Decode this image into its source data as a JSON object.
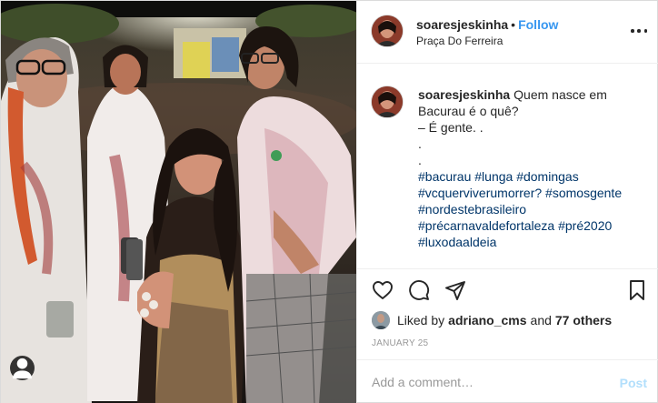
{
  "post": {
    "username": "soaresjeskinha",
    "follow_label": "Follow",
    "separator": "•",
    "location": "Praça Do Ferreira"
  },
  "caption": {
    "username": "soaresjeskinha",
    "lines": [
      "Quem nasce em",
      "Bacurau é o quê?",
      "– É gente. .",
      ".",
      "."
    ],
    "hashtags": [
      "#bacurau #lunga #domingas",
      "#vcquerviverumorrer? #somosgente",
      "#nordestebrasileiro",
      "#précarnavaldefortaleza #pré2020",
      "#luxodaaldeia"
    ]
  },
  "actions": {
    "like_icon": "heart-icon",
    "comment_icon": "comment-icon",
    "share_icon": "share-icon",
    "save_icon": "bookmark-icon"
  },
  "likes": {
    "prefix": "Liked by",
    "user": "adriano_cms",
    "conj": "and",
    "others": "77 others"
  },
  "date": "JANUARY 25",
  "comment": {
    "placeholder": "Add a comment…",
    "post_label": "Post"
  },
  "colors": {
    "link": "#3897f0",
    "hashtag": "#003569",
    "muted": "#999999",
    "post_disabled": "#b2dffc"
  }
}
